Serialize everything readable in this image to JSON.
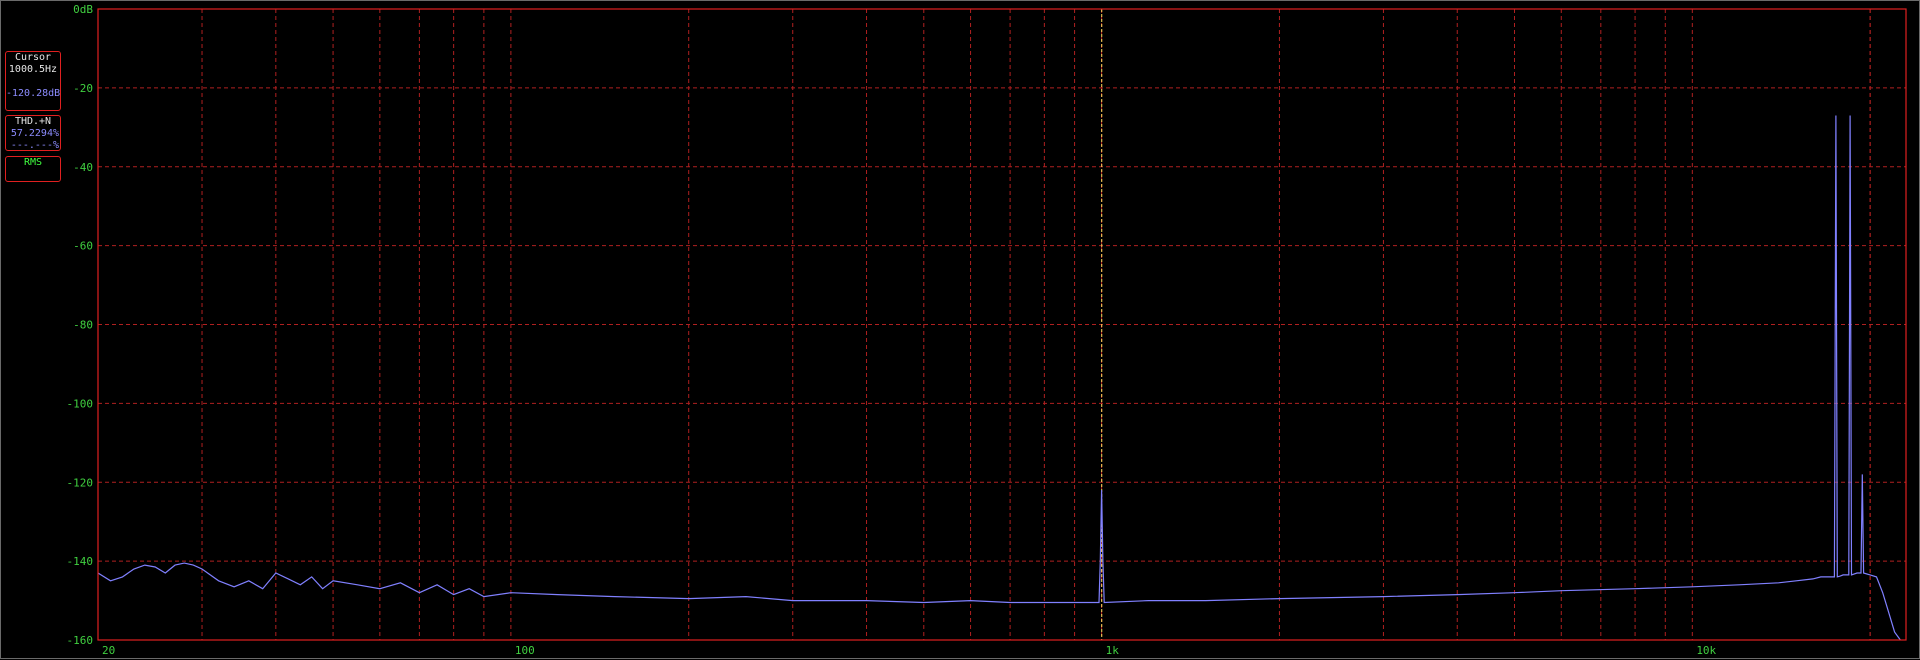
{
  "panels": {
    "cursor": {
      "title": "Cursor",
      "freq": "1000.5Hz",
      "level": "-120.28dB"
    },
    "thd": {
      "title": "THD.+N",
      "value": "57.2294%",
      "value2": "---.---%"
    },
    "rms": {
      "title": "RMS"
    }
  },
  "colors": {
    "grid": "#b02020",
    "frame": "#e02020",
    "trace": "#8080ff",
    "cursor": "#ffe060",
    "axis_text": "#40d040"
  },
  "chart_data": {
    "type": "line",
    "title": "",
    "xlabel": "",
    "ylabel": "",
    "x_scale": "log",
    "xlim": [
      20,
      23000
    ],
    "ylim": [
      -160,
      0
    ],
    "grid": true,
    "yticks": [
      {
        "value": 0,
        "label": "0dB"
      },
      {
        "value": -20,
        "label": "-20"
      },
      {
        "value": -40,
        "label": "-40"
      },
      {
        "value": -60,
        "label": "-60"
      },
      {
        "value": -80,
        "label": "-80"
      },
      {
        "value": -100,
        "label": "-100"
      },
      {
        "value": -120,
        "label": "-120"
      },
      {
        "value": -140,
        "label": "-140"
      },
      {
        "value": -160,
        "label": "-160"
      }
    ],
    "xticks": [
      {
        "value": 20,
        "label": "20"
      },
      {
        "value": 100,
        "label": "100"
      },
      {
        "value": 1000,
        "label": "1k"
      },
      {
        "value": 10000,
        "label": "10k"
      }
    ],
    "cursor_x": 1000.5,
    "series": [
      {
        "values": [
          [
            20,
            -143
          ],
          [
            21,
            -145
          ],
          [
            22,
            -144
          ],
          [
            23,
            -142
          ],
          [
            24,
            -141
          ],
          [
            25,
            -141.5
          ],
          [
            26,
            -143
          ],
          [
            27,
            -141
          ],
          [
            28,
            -140.5
          ],
          [
            29,
            -141
          ],
          [
            30,
            -142
          ],
          [
            32,
            -145
          ],
          [
            34,
            -146.5
          ],
          [
            36,
            -145
          ],
          [
            38,
            -147
          ],
          [
            40,
            -143
          ],
          [
            42,
            -144.5
          ],
          [
            44,
            -146
          ],
          [
            46,
            -144
          ],
          [
            48,
            -147
          ],
          [
            50,
            -145
          ],
          [
            55,
            -146
          ],
          [
            60,
            -147
          ],
          [
            65,
            -145.5
          ],
          [
            70,
            -148
          ],
          [
            75,
            -146
          ],
          [
            80,
            -148.5
          ],
          [
            85,
            -147
          ],
          [
            90,
            -149
          ],
          [
            100,
            -148
          ],
          [
            120,
            -148.5
          ],
          [
            150,
            -149
          ],
          [
            200,
            -149.5
          ],
          [
            250,
            -149
          ],
          [
            300,
            -150
          ],
          [
            400,
            -150
          ],
          [
            500,
            -150.5
          ],
          [
            600,
            -150
          ],
          [
            700,
            -150.5
          ],
          [
            800,
            -150.5
          ],
          [
            900,
            -150.5
          ],
          [
            990,
            -150.5
          ],
          [
            995,
            -140
          ],
          [
            1000,
            -122
          ],
          [
            1005,
            -140
          ],
          [
            1010,
            -150.5
          ],
          [
            1200,
            -150
          ],
          [
            1500,
            -150
          ],
          [
            2000,
            -149.5
          ],
          [
            3000,
            -149
          ],
          [
            4000,
            -148.5
          ],
          [
            5000,
            -148
          ],
          [
            6000,
            -147.5
          ],
          [
            8000,
            -147
          ],
          [
            10000,
            -146.5
          ],
          [
            12000,
            -146
          ],
          [
            14000,
            -145.5
          ],
          [
            15000,
            -145
          ],
          [
            16000,
            -144.5
          ],
          [
            16500,
            -144
          ],
          [
            17000,
            -144
          ],
          [
            17400,
            -144
          ],
          [
            17500,
            -27
          ],
          [
            17600,
            -144
          ],
          [
            17800,
            -143.8
          ],
          [
            18000,
            -143.5
          ],
          [
            18400,
            -143.5
          ],
          [
            18500,
            -27
          ],
          [
            18600,
            -143.5
          ],
          [
            19000,
            -143
          ],
          [
            19300,
            -143
          ],
          [
            19400,
            -118
          ],
          [
            19500,
            -143
          ],
          [
            20000,
            -143.5
          ],
          [
            20500,
            -144
          ],
          [
            21000,
            -148
          ],
          [
            21500,
            -153
          ],
          [
            22000,
            -158
          ],
          [
            22500,
            -160
          ]
        ]
      }
    ]
  }
}
